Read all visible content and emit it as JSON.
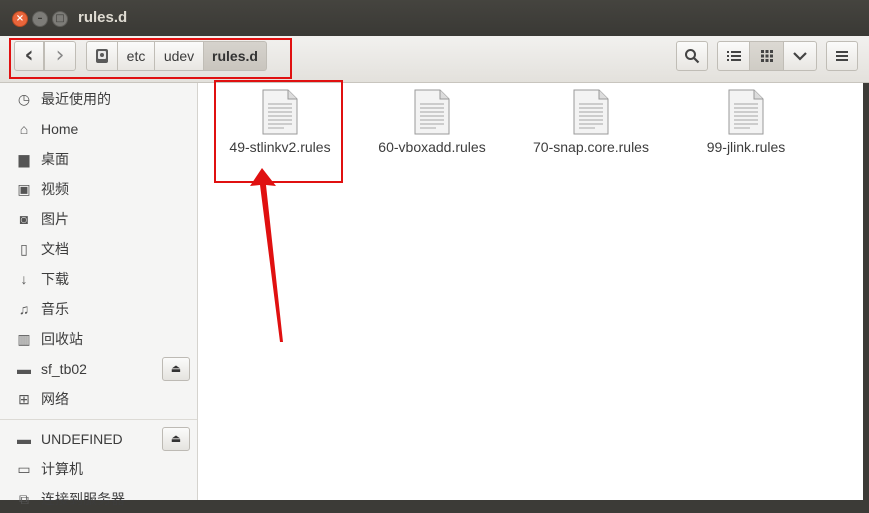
{
  "window": {
    "title": "rules.d",
    "close_glyph": "×",
    "minimize_glyph": "–",
    "maximize_glyph": "□"
  },
  "toolbar": {
    "back_icon": "‹",
    "forward_icon": "›",
    "breadcrumbs": [
      "etc",
      "udev",
      "rules.d"
    ],
    "search_icon": "search-icon",
    "view_list_icon": "list-view-icon",
    "view_grid_icon": "grid-view-icon",
    "view_options_icon": "chevron-down-icon",
    "menu_icon": "hamburger-icon"
  },
  "sidebar": {
    "items": [
      {
        "label": "最近使用的",
        "icon": "recent-icon"
      },
      {
        "label": "Home",
        "icon": "home-icon"
      },
      {
        "label": "桌面",
        "icon": "desktop-icon"
      },
      {
        "label": "视频",
        "icon": "video-icon"
      },
      {
        "label": "图片",
        "icon": "pictures-icon"
      },
      {
        "label": "文档",
        "icon": "documents-icon"
      },
      {
        "label": "下载",
        "icon": "downloads-icon"
      },
      {
        "label": "音乐",
        "icon": "music-icon"
      },
      {
        "label": "回收站",
        "icon": "trash-icon"
      },
      {
        "label": "sf_tb02",
        "icon": "drive-icon",
        "eject": true
      },
      {
        "label": "网络",
        "icon": "network-icon"
      },
      {
        "label": "UNDEFINED",
        "icon": "drive-icon",
        "eject": true
      },
      {
        "label": "计算机",
        "icon": "computer-icon"
      },
      {
        "label": "连接到服务器",
        "icon": "server-icon"
      }
    ]
  },
  "files": [
    {
      "name": "49-stlinkv2.rules",
      "icon": "text-file-icon"
    },
    {
      "name": "60-vboxadd.rules",
      "icon": "text-file-icon"
    },
    {
      "name": "70-snap.core.rules",
      "icon": "text-file-icon"
    },
    {
      "name": "99-jlink.rules",
      "icon": "text-file-icon"
    }
  ],
  "annotation": {
    "color": "#e01010"
  }
}
